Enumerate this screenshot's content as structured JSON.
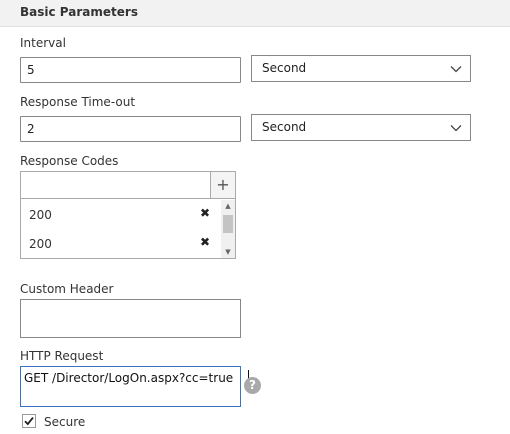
{
  "section": {
    "title": "Basic Parameters"
  },
  "interval": {
    "label": "Interval",
    "value": "5",
    "unit": "Second"
  },
  "response_timeout": {
    "label": "Response Time-out",
    "value": "2",
    "unit": "Second"
  },
  "response_codes": {
    "label": "Response Codes",
    "input_value": "",
    "add_glyph": "+",
    "items": [
      "200",
      "200"
    ],
    "delete_glyph": "✖"
  },
  "custom_header": {
    "label": "Custom Header",
    "value": ""
  },
  "http_request": {
    "label": "HTTP Request",
    "value": "GET /Director/LogOn.aspx?cc=true",
    "help_glyph": "?"
  },
  "secure": {
    "label": "Secure",
    "checked": true
  },
  "icons": {
    "dropdown": "chevron-down-icon",
    "add": "plus-icon",
    "remove": "close-icon",
    "help": "help-icon",
    "check": "checkmark-icon"
  },
  "colors": {
    "header_bg": "#f2f2f2",
    "focus_border": "#3a72c4",
    "help_icon": "#a9a9a9"
  }
}
